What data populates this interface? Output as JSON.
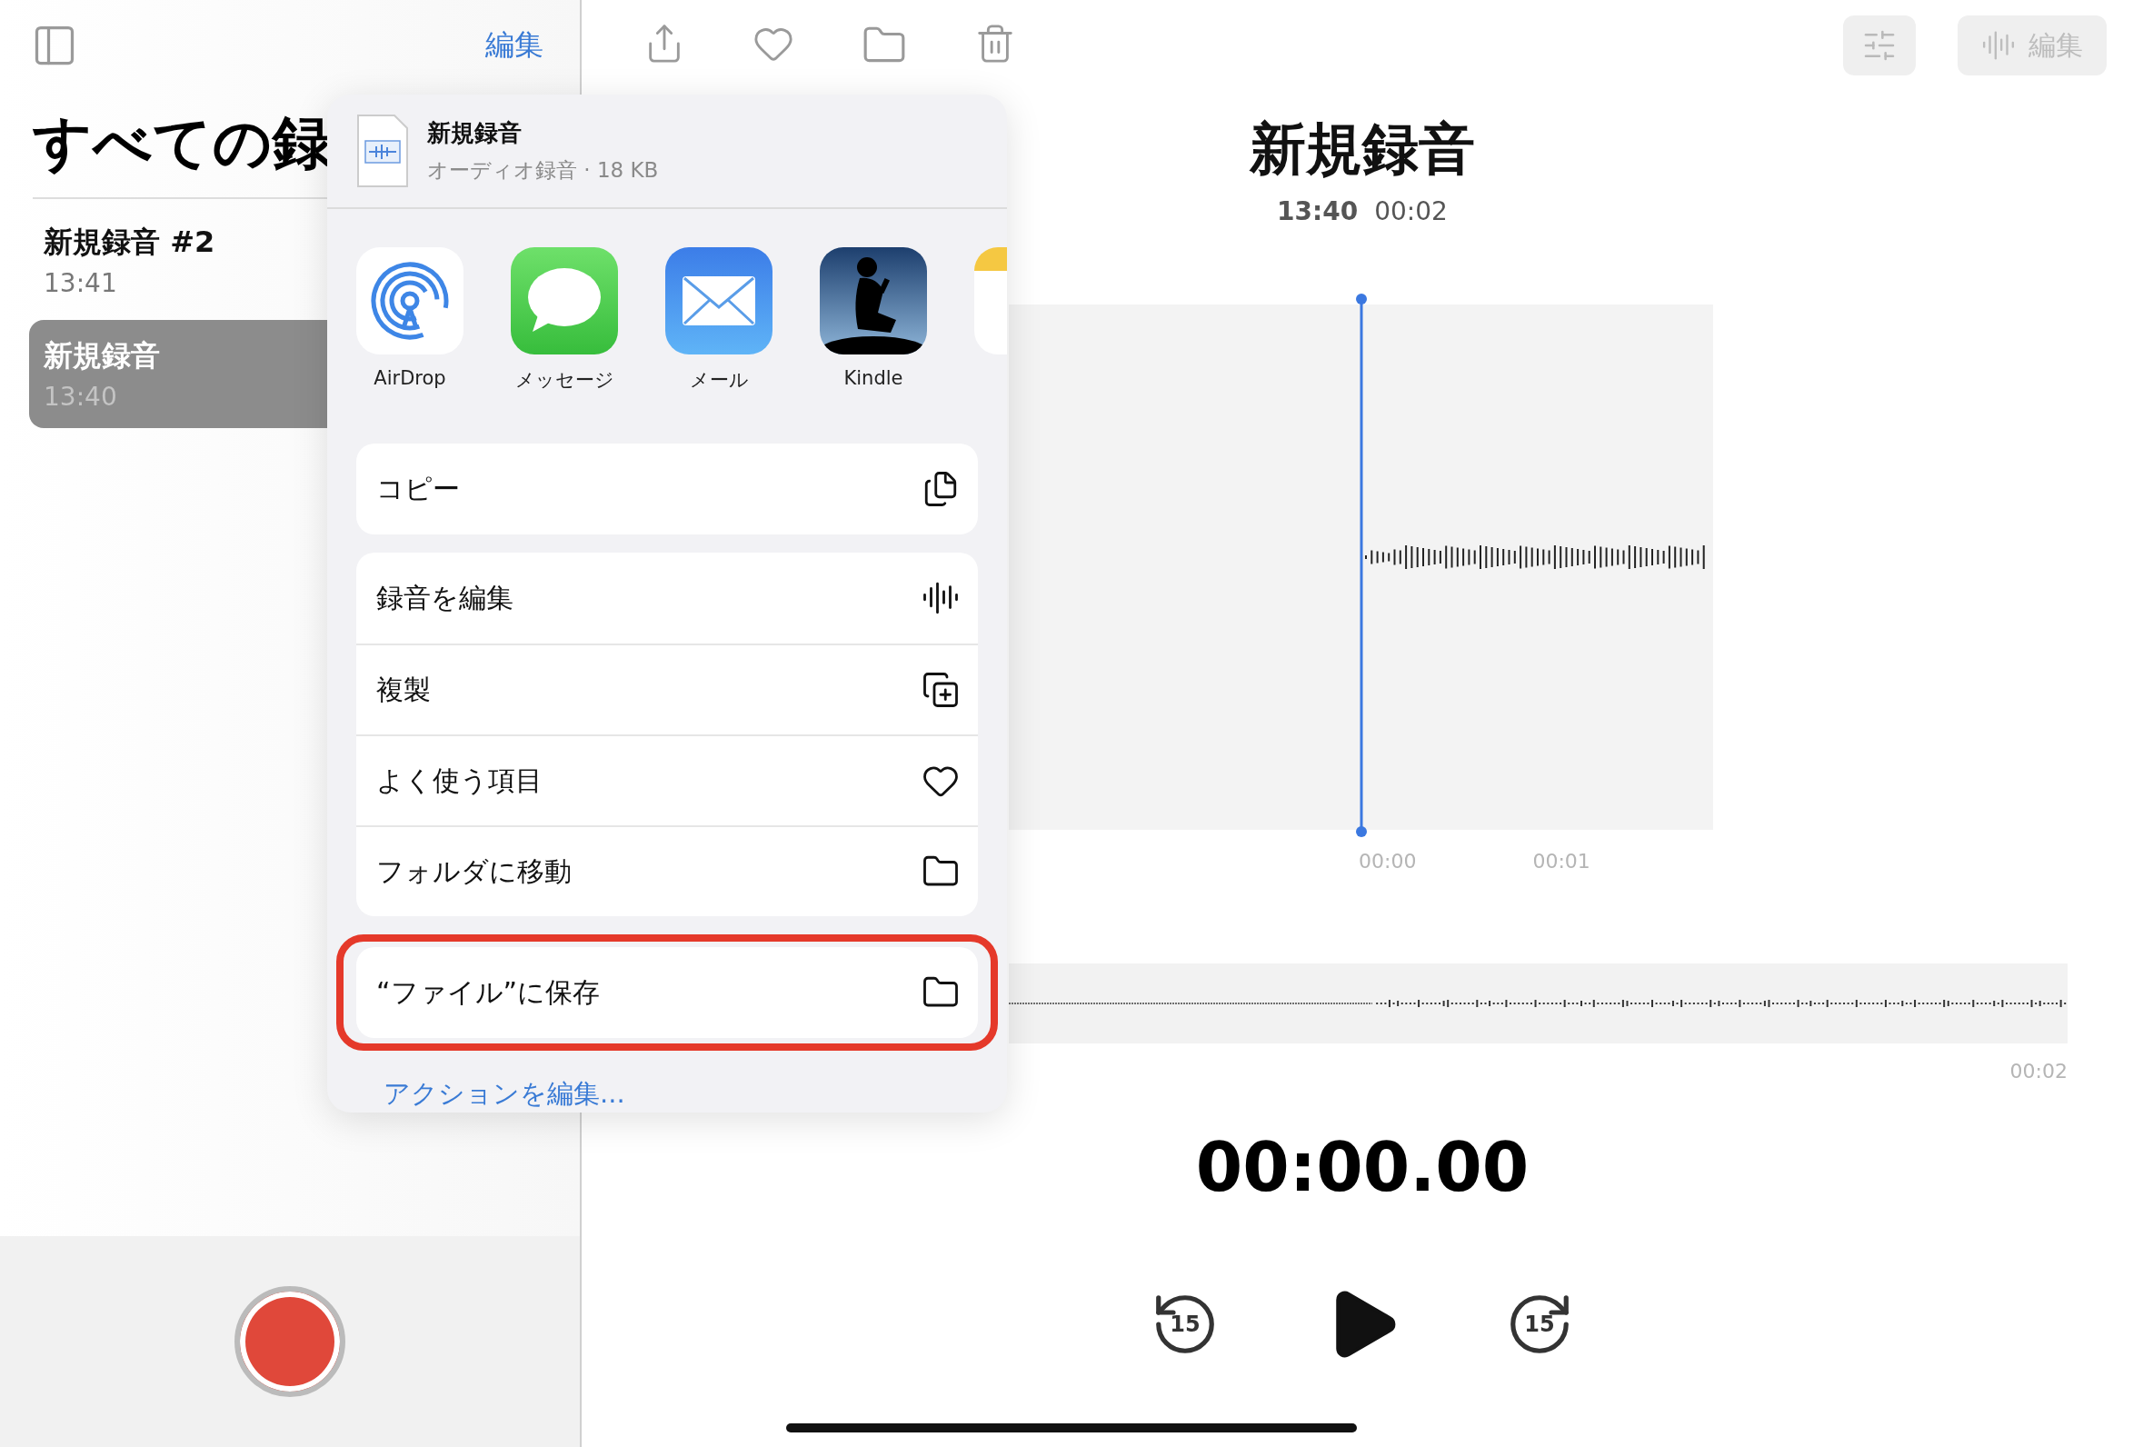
{
  "sidebar": {
    "edit_label": "編集",
    "title": "すべての録",
    "recordings": [
      {
        "name": "新規録音 #2",
        "time": "13:41",
        "selected": false
      },
      {
        "name": "新規録音",
        "time": "13:40",
        "selected": true
      }
    ]
  },
  "share_sheet": {
    "file_name": "新規録音",
    "file_info": "オーディオ録音 · 18 KB",
    "apps": [
      {
        "kind": "airdrop",
        "label": "AirDrop"
      },
      {
        "kind": "messages",
        "label": "メッセージ"
      },
      {
        "kind": "mail",
        "label": "メール"
      },
      {
        "kind": "kindle",
        "label": "Kindle"
      },
      {
        "kind": "notes"
      }
    ],
    "action_groups": [
      {
        "highlighted": false,
        "actions": [
          {
            "kind": "copy",
            "label": "コピー"
          }
        ]
      },
      {
        "highlighted": false,
        "actions": [
          {
            "kind": "waveform",
            "label": "録音を編集"
          },
          {
            "kind": "duplicate",
            "label": "複製"
          },
          {
            "kind": "heart",
            "label": "よく使う項目"
          },
          {
            "kind": "folder",
            "label": "フォルダに移動"
          }
        ]
      },
      {
        "highlighted": true,
        "actions": [
          {
            "kind": "folder",
            "label": "“ファイル”に保存"
          }
        ]
      }
    ],
    "edit_actions_link": "アクションを編集..."
  },
  "detail": {
    "edit_button": {
      "label": "編集",
      "disabled": true
    },
    "title": "新規録音",
    "time": "13:40",
    "duration": "00:02",
    "ticks": [
      "00:00",
      "00:01"
    ],
    "end_time": "00:02",
    "elapsed": "00:00.00",
    "skip_back": "15",
    "skip_forward": "15"
  }
}
